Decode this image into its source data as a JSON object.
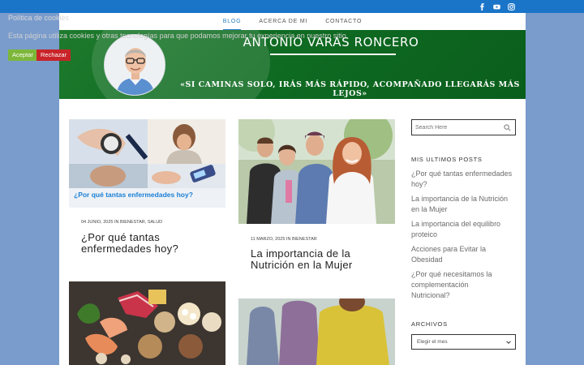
{
  "nav": {
    "items": [
      "BLOG",
      "ACERCA DE MI",
      "CONTACTO"
    ]
  },
  "banner": {
    "title": "ANTONIO VARAS RONCERO",
    "slogan": "«SI CAMINAS SOLO, IRÁS MÁS RÁPIDO, ACOMPAÑADO LLEGARÁS MÁS LEJOS»"
  },
  "posts": [
    {
      "image_caption": "¿Por qué tantas enfermedades hoy?",
      "meta": "04 JUNIO, 2025 IN BIENESTAR, SALUD",
      "title_lines": [
        "¿Por qué tantas",
        "enfermedades hoy?"
      ]
    },
    {
      "meta": "11 MARZO, 2025 IN BIENESTAR",
      "title_lines": [
        "La importancia de la",
        "Nutrición en la Mujer"
      ]
    }
  ],
  "sidebar": {
    "search_placeholder": "Search Here",
    "recent_heading": "MIS ULTIMOS POSTS",
    "recent_posts": [
      [
        "¿Por qué tantas enfermedades",
        "hoy?"
      ],
      [
        "La importancia de la Nutrición",
        "en la Mujer"
      ],
      [
        "La importancia del equilibro",
        "proteico"
      ],
      [
        "Acciones para Evitar la",
        "Obesidad"
      ],
      [
        "¿Por qué necesitamos la",
        "complementación",
        "Nutricional?"
      ]
    ],
    "archive_heading": "ARCHIVOS",
    "archive_select": "Elegir el mes"
  },
  "cookies": {
    "title": "Política de cookies",
    "text": "Esta página utiliza cookies y otras tecnologías para que podamos mejorar tu experiencia en nuestro sitio.",
    "accept": "Aceptar",
    "reject": "Rechazar"
  },
  "icons": [
    "facebook-icon",
    "youtube-icon",
    "instagram-icon",
    "search-icon",
    "chevron-down-icon"
  ],
  "colors": {
    "topbar": "#1a75c9",
    "banner": "#127227",
    "accent": "#2a7fc2",
    "accept": "#7db73a",
    "reject": "#c8242a"
  }
}
